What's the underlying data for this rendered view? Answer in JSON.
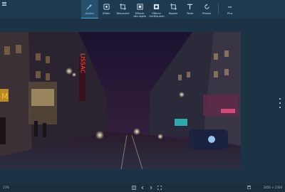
{
  "toolbar": {
    "items": [
      {
        "icon": "magic-wand-icon",
        "label": "Ajuster",
        "active": true
      },
      {
        "icon": "effects-icon",
        "label": "Effets"
      },
      {
        "icon": "crop-icon",
        "label": "Retoucher"
      },
      {
        "icon": "erase-objects-icon",
        "label": "Effacer",
        "label2": "des objets"
      },
      {
        "icon": "erase-background-icon",
        "label": "Effacer",
        "label2": "l'arrière-plan"
      },
      {
        "icon": "crop-square-icon",
        "label": "Rogner"
      },
      {
        "icon": "text-icon",
        "label": "Texte"
      },
      {
        "icon": "rotate-icon",
        "label": "Pivoter"
      },
      {
        "icon": "more-icon",
        "label": "Plus"
      }
    ]
  },
  "status": {
    "zoom": "23%",
    "image_size": "3456 × 2304"
  },
  "colors": {
    "bar_bg": "#1d3a50",
    "canvas_bg": "#1c3345",
    "accent": "#49a6e6"
  },
  "photo": {
    "neon_sign": "LISSAC"
  }
}
